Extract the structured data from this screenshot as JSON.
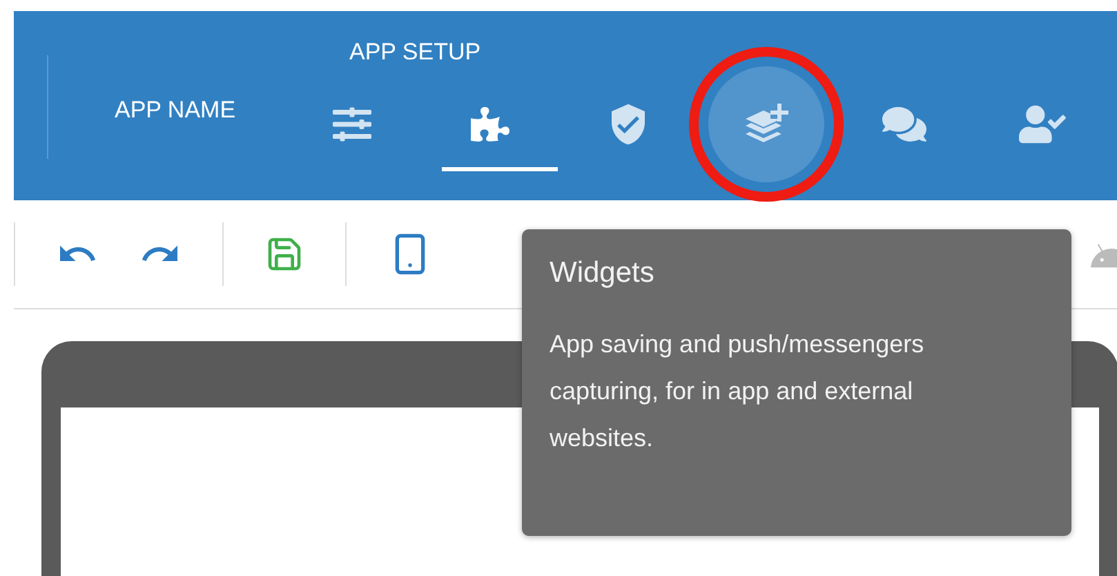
{
  "header": {
    "app_name": "APP NAME",
    "section_title": "APP SETUP",
    "tabs": [
      {
        "kind": "sliders",
        "selected": false,
        "highlighted": false
      },
      {
        "kind": "puzzle",
        "selected": true,
        "highlighted": false
      },
      {
        "kind": "shield",
        "selected": false,
        "highlighted": false
      },
      {
        "kind": "layers",
        "selected": false,
        "highlighted": true
      },
      {
        "kind": "chat",
        "selected": false,
        "highlighted": false
      },
      {
        "kind": "user",
        "selected": false,
        "highlighted": false
      }
    ]
  },
  "toolbar": {
    "groups": [
      [
        {
          "kind": "undo"
        },
        {
          "kind": "redo"
        }
      ],
      [
        {
          "kind": "save"
        }
      ],
      [
        {
          "kind": "phone"
        }
      ]
    ],
    "trailing": {
      "kind": "android"
    }
  },
  "tooltip": {
    "title": "Widgets",
    "text": "App saving and push/messengers capturing, for in app and external websites."
  }
}
